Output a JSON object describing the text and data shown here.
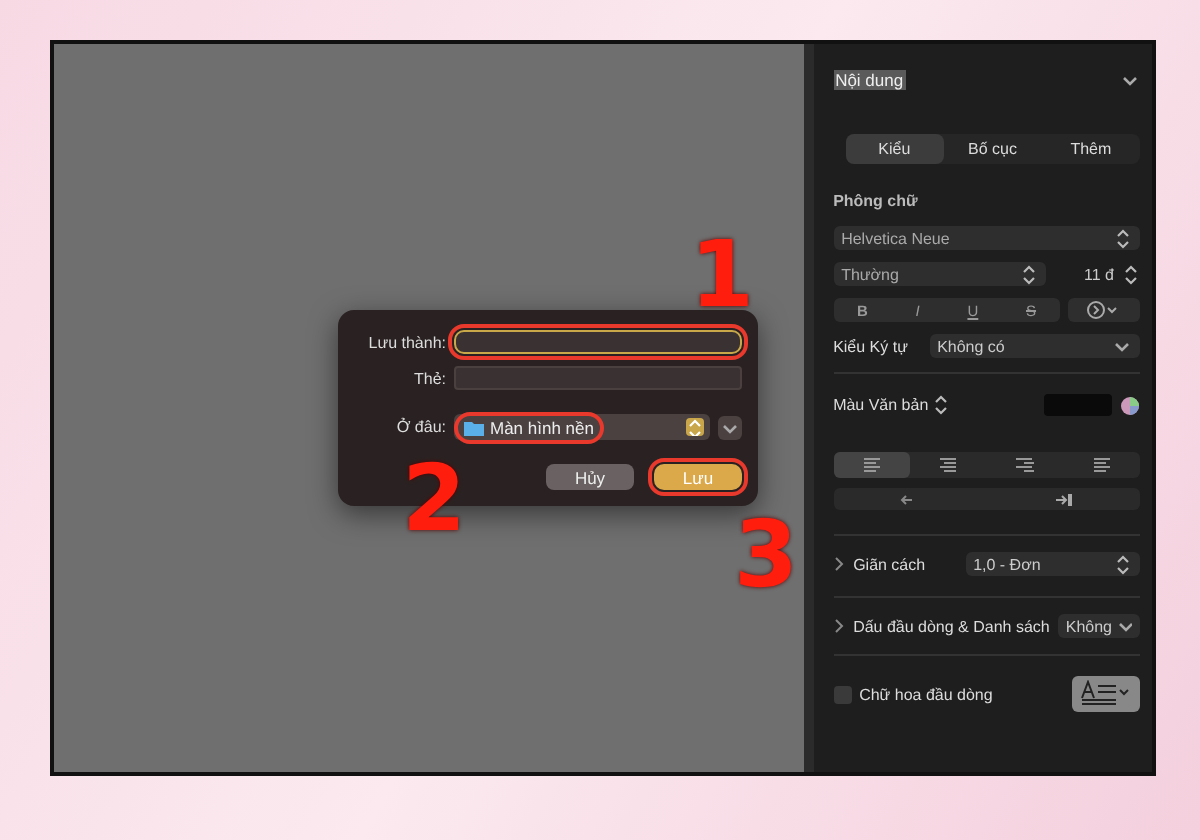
{
  "dialog": {
    "fields": [
      {
        "label": "Lưu thành:",
        "focused": true,
        "highlighted": true
      },
      {
        "label": "Thẻ:",
        "focused": false,
        "highlighted": false
      }
    ],
    "location": {
      "label": "Ở đâu:",
      "value": "Màn hình nền",
      "highlighted": true
    },
    "buttons": [
      {
        "label": "Hủy",
        "kind": "secondary",
        "highlighted": false
      },
      {
        "label": "Lưu",
        "kind": "primary",
        "highlighted": true
      }
    ]
  },
  "annotations": [
    {
      "label": "1"
    },
    {
      "label": "2"
    },
    {
      "label": "3"
    }
  ],
  "panel": {
    "section": "Nội dung",
    "tabs": [
      {
        "label": "Kiểu",
        "selected": true
      },
      {
        "label": "Bố cục",
        "selected": false
      },
      {
        "label": "Thêm",
        "selected": false
      }
    ],
    "font_heading": "Phông chữ",
    "font": "Helvetica Neue",
    "style": "Thường",
    "size": "11 đ",
    "format_buttons": [
      {
        "label": "B",
        "kind": "bold"
      },
      {
        "label": "I",
        "kind": "italic"
      },
      {
        "label": "U",
        "kind": "underline"
      },
      {
        "label": "S",
        "kind": "strike"
      }
    ],
    "char_style": {
      "label": "Kiểu Ký tự",
      "value": "Không có"
    },
    "text_color": {
      "label": "Màu Văn bản"
    },
    "alignment": [
      {
        "selected": true
      },
      {
        "selected": false
      },
      {
        "selected": false
      },
      {
        "selected": false
      }
    ],
    "spacing": {
      "label": "Giãn cách",
      "value": "1,0 - Đơn"
    },
    "bullets": {
      "label": "Dấu đầu dòng & Danh sách",
      "value": "Không"
    },
    "drop_cap": {
      "label": "Chữ hoa đầu dòng",
      "checked": false
    }
  }
}
